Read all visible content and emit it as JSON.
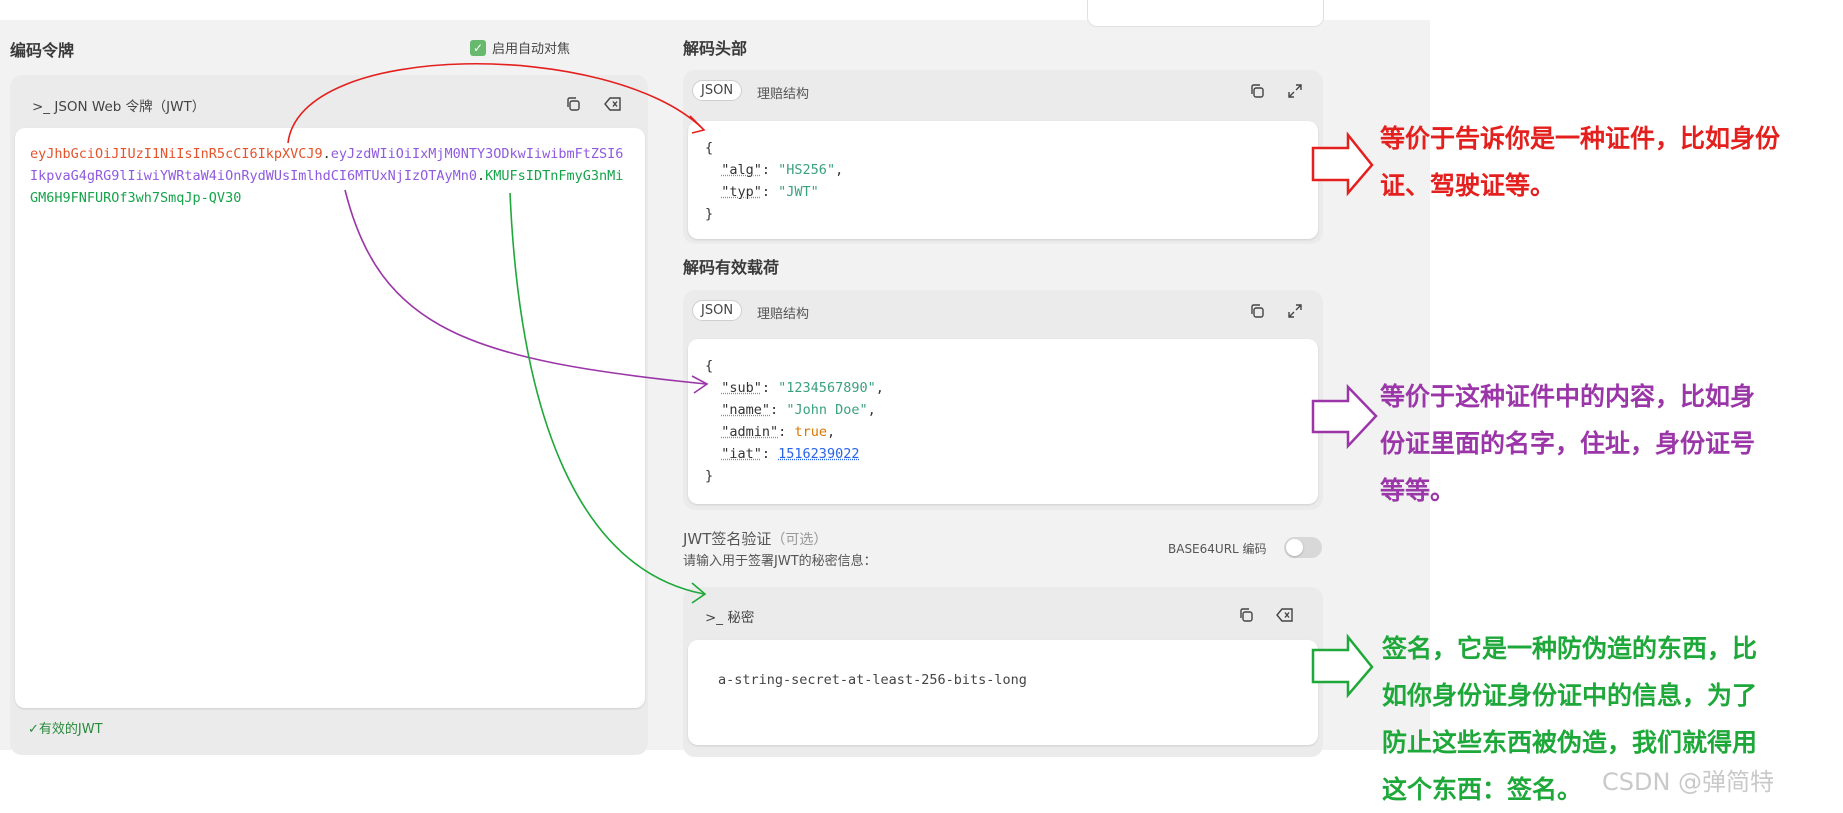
{
  "encoded": {
    "title": "编码令牌",
    "auto_focus_label": "启用自动对焦",
    "token_panel_title": ">_ JSON Web 令牌（JWT）",
    "token_header": "eyJhbGciOiJIUzI1NiIsInR5cCI6IkpXVCJ9",
    "dot1": ".",
    "token_payload": "eyJzdWIiOiIxMjM0NTY3ODkwIiwibmFtZSI6IkpvaG4gRG9lIiwiYWRtaW4iOnRydWUsImlhdCI6MTUxNjIzOTAyMn0",
    "dot2": ".",
    "token_signature": "KMUFsIDTnFmyG3nMiGM6H9FNFUROf3wh7SmqJp-QV30",
    "valid_label": "✓有效的JWT"
  },
  "header": {
    "title": "解码头部",
    "tab_json": "JSON",
    "tab_struct": "理赔结构",
    "open_brace": "{",
    "close_brace": "}",
    "fields": [
      {
        "key": "\"alg\"",
        "colon": ": ",
        "value": "\"HS256\"",
        "comma": ","
      },
      {
        "key": "\"typ\"",
        "colon": ": ",
        "value": "\"JWT\"",
        "comma": ""
      }
    ]
  },
  "payload": {
    "title": "解码有效载荷",
    "tab_json": "JSON",
    "tab_struct": "理赔结构",
    "open_brace": "{",
    "close_brace": "}",
    "fields": [
      {
        "key": "\"sub\"",
        "colon": ": ",
        "value": "\"1234567890\"",
        "comma": ","
      },
      {
        "key": "\"name\"",
        "colon": ": ",
        "value": "\"John Doe\"",
        "comma": ","
      },
      {
        "key": "\"admin\"",
        "colon": ": ",
        "value": "true",
        "comma": ","
      },
      {
        "key": "\"iat\"",
        "colon": ": ",
        "value": "1516239022",
        "comma": ""
      }
    ]
  },
  "signature": {
    "title": "JWT签名验证",
    "optional": "（可选）",
    "hint": "请输入用于签署JWT的秘密信息：",
    "base64_label": "BASE64URL 编码",
    "base64_on": false,
    "secret_title": ">_ 秘密",
    "secret_value": "a-string-secret-at-least-256-bits-long"
  },
  "annotations": {
    "header_note": [
      "等价于告诉你是一种证件，比如身份",
      "证、驾驶证等。"
    ],
    "payload_note": [
      "等价于这种证件中的内容，比如身",
      "份证里面的名字，住址，身份证号",
      "等等。"
    ],
    "signature_note": [
      "签名，它是一种防伪造的东西，比",
      "如你身份证身份证中的信息，为了",
      "防止这些东西被伪造，我们就得用",
      "这个东西：签名。"
    ],
    "red": "#e4201e",
    "purple": "#9b36a8",
    "green": "#1ea83a"
  },
  "watermark": "CSDN @弹简特"
}
